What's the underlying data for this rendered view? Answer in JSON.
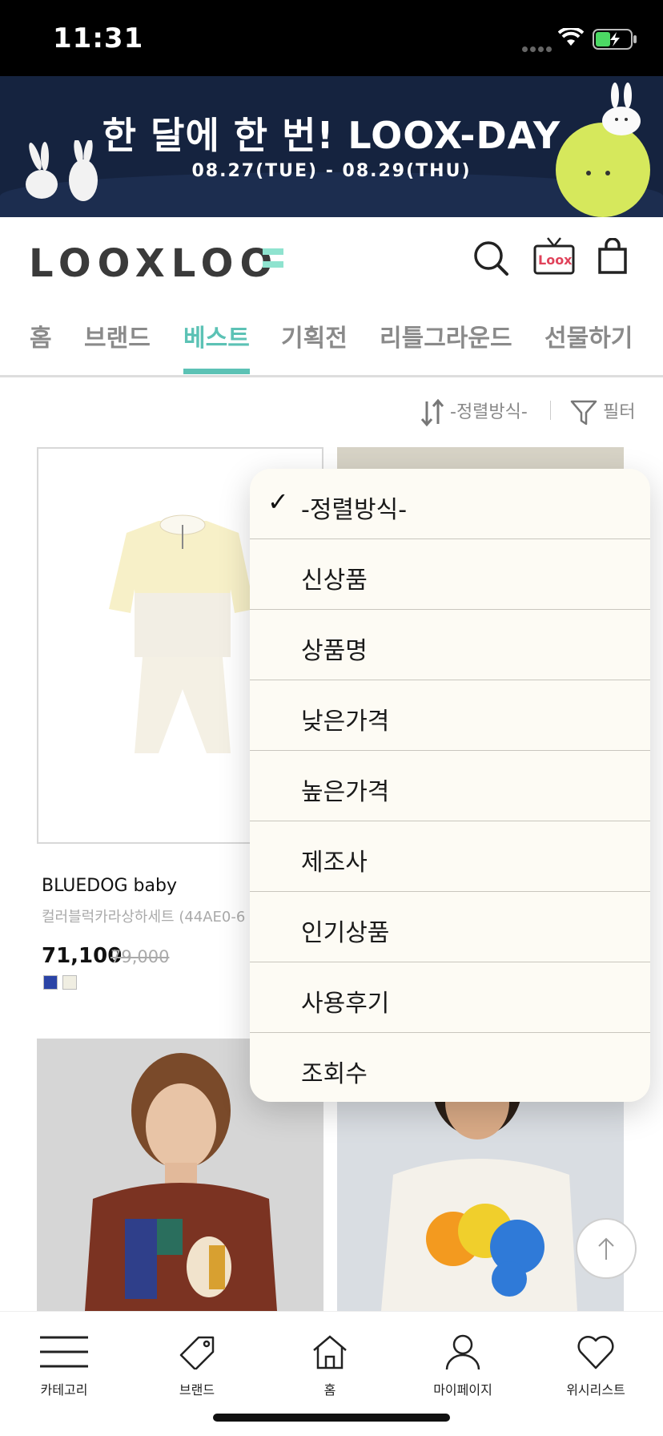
{
  "status_bar": {
    "time": "11:31"
  },
  "banner": {
    "title": "한 달에 한 번! LOOX-DAY",
    "dates": "08.27(TUE) - 08.29(THU)"
  },
  "header": {
    "logo": "LOOXLOO",
    "tv_label": "Loox"
  },
  "nav": {
    "tabs": [
      {
        "label": "홈"
      },
      {
        "label": "브랜드"
      },
      {
        "label": "베스트",
        "active": true
      },
      {
        "label": "기획전"
      },
      {
        "label": "리틀그라운드"
      },
      {
        "label": "선물하기"
      }
    ]
  },
  "toolbar": {
    "sort_label": "-정렬방식-",
    "filter_label": "필터"
  },
  "products": [
    {
      "brand": "BLUEDOG baby",
      "name": "컬러블럭카라상하세트 (44AE0-6",
      "price": "71,100",
      "original_price": "79,000",
      "swatches": [
        "#2b44a6",
        "#f0eee2"
      ]
    }
  ],
  "sort_dropdown": {
    "selected": "-정렬방식-",
    "options": [
      "-정렬방식-",
      "신상품",
      "상품명",
      "낮은가격",
      "높은가격",
      "제조사",
      "인기상품",
      "사용후기",
      "조회수"
    ]
  },
  "tabbar": {
    "items": [
      {
        "label": "카테고리",
        "icon": "menu-icon"
      },
      {
        "label": "브랜드",
        "icon": "tag-icon"
      },
      {
        "label": "홈",
        "icon": "home-icon"
      },
      {
        "label": "마이페이지",
        "icon": "person-icon"
      },
      {
        "label": "위시리스트",
        "icon": "heart-icon"
      }
    ]
  },
  "colors": {
    "accent": "#5cc2b5",
    "banner_bg": "#15233f",
    "moon": "#d6e85c"
  }
}
